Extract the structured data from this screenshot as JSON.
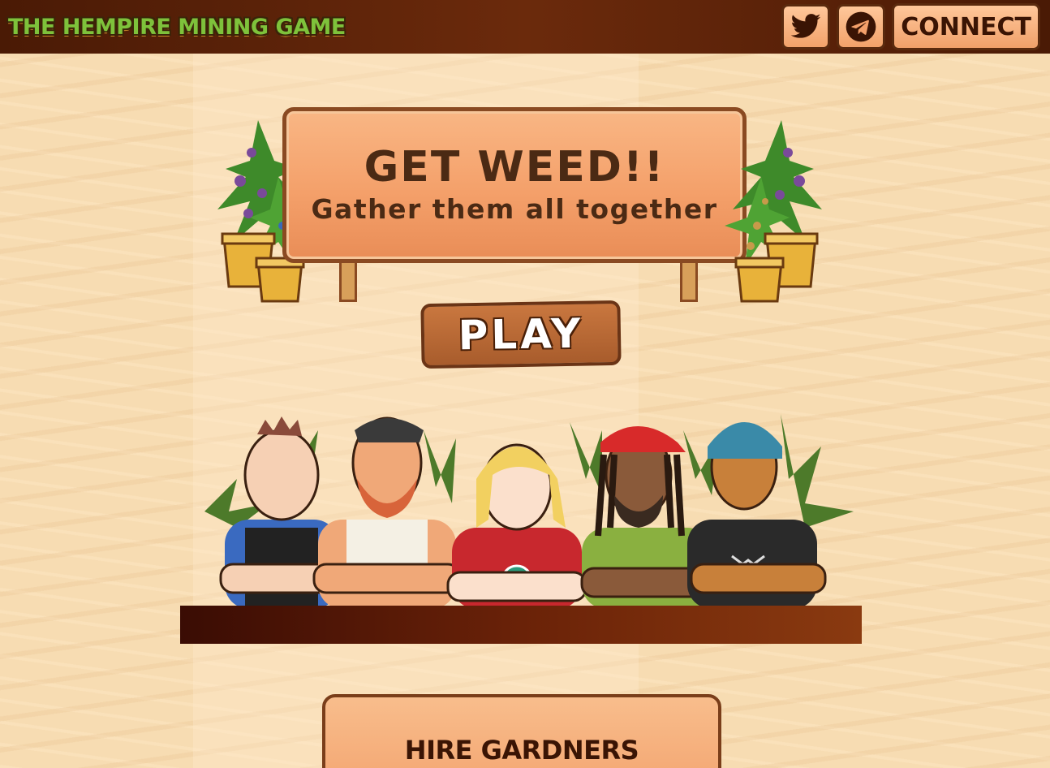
{
  "header": {
    "logo_text": "THE HEMPIRE MINING GAME",
    "twitter_icon": "twitter-icon",
    "telegram_icon": "telegram-icon",
    "connect_label": "CONNECT"
  },
  "sign": {
    "title": "GET WEED!!",
    "subtitle": "Gather them all together"
  },
  "play": {
    "label": "PLAY"
  },
  "hire": {
    "title": "HIRE GARDNERS"
  },
  "colors": {
    "header_bg": "#5a2208",
    "logo_green": "#7ec23b",
    "button_peach": "#f4a06a",
    "wood_dark": "#6a3416",
    "background": "#f7dcb2"
  }
}
